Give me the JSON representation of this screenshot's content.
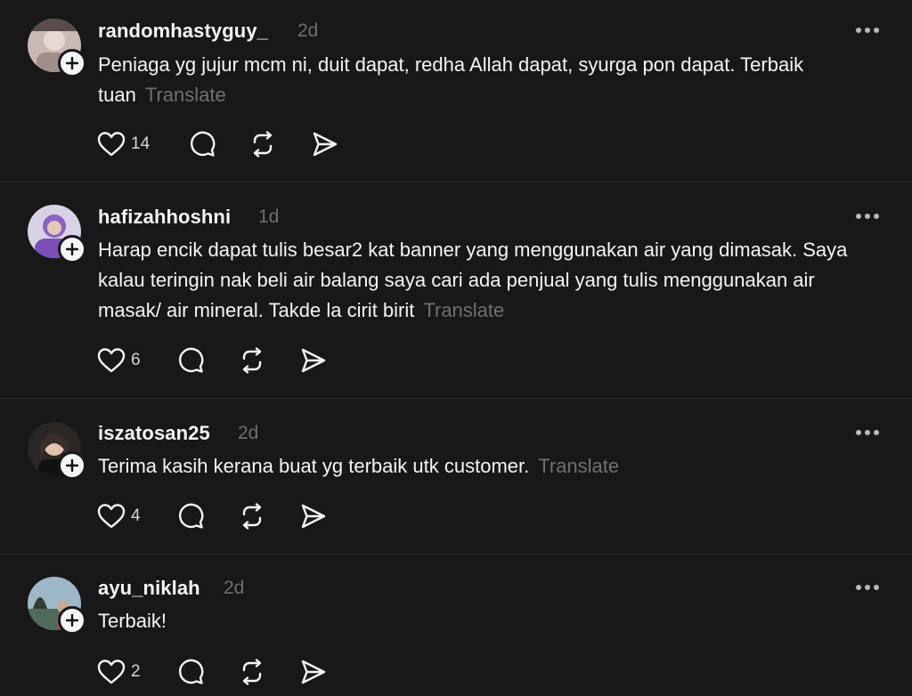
{
  "posts": [
    {
      "username": "randomhastyguy_",
      "time": "2d",
      "text": "Peniaga yg jujur mcm ni, duit dapat, redha Allah dapat, syurga pon dapat. Terbaik tuan",
      "translate_label": "Translate",
      "likes": "14"
    },
    {
      "username": "hafizahhoshni",
      "time": "1d",
      "text": "Harap encik dapat tulis besar2 kat banner yang menggunakan air yang dimasak. Saya kalau teringin nak beli air balang saya cari ada penjual yang tulis menggunakan air masak/ air mineral. Takde la cirit birit",
      "translate_label": "Translate",
      "likes": "6"
    },
    {
      "username": "iszatosan25",
      "time": "2d",
      "text": "Terima kasih kerana buat yg terbaik utk customer.",
      "translate_label": "Translate",
      "likes": "4"
    },
    {
      "username": "ayu_niklah",
      "time": "2d",
      "text": "Terbaik!",
      "translate_label": "",
      "likes": "2"
    }
  ],
  "colors": {
    "background": "#181818",
    "text": "#f3f5f7",
    "muted": "#6f6f6f",
    "divider": "#2e2e2e"
  },
  "icons": [
    "heart-icon",
    "comment-icon",
    "repost-icon",
    "share-icon",
    "more-icon",
    "follow-plus-icon"
  ]
}
